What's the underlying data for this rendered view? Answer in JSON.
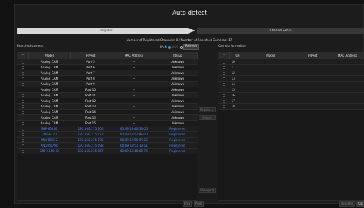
{
  "window": {
    "title": "Auto detect"
  },
  "steps": {
    "step1": "Register",
    "step2": "Channel Setup"
  },
  "info": "Number of Registered Channels: 0 / Number of Searched Cameras: 17",
  "searched": {
    "label": "Searched camera",
    "ipv4_label": "IPv4",
    "ipv6_label": "IPv6",
    "refresh_label": "Refresh",
    "columns": [
      "Model",
      "IP/Port",
      "MAC Address",
      "Status"
    ],
    "rows": [
      {
        "model": "Analog CAM",
        "ip": "Port 5",
        "mac": "--",
        "status": "Unknown",
        "kind": "analog"
      },
      {
        "model": "Analog CAM",
        "ip": "Port 6",
        "mac": "--",
        "status": "Unknown",
        "kind": "analog"
      },
      {
        "model": "Analog CAM",
        "ip": "Port 7",
        "mac": "--",
        "status": "Unknown",
        "kind": "analog"
      },
      {
        "model": "Analog CAM",
        "ip": "Port 8",
        "mac": "--",
        "status": "Unknown",
        "kind": "analog"
      },
      {
        "model": "Analog CAM",
        "ip": "Port 9",
        "mac": "--",
        "status": "Unknown",
        "kind": "analog"
      },
      {
        "model": "Analog CAM",
        "ip": "Port 10",
        "mac": "--",
        "status": "Unknown",
        "kind": "analog"
      },
      {
        "model": "Analog CAM",
        "ip": "Port 11",
        "mac": "--",
        "status": "Unknown",
        "kind": "analog"
      },
      {
        "model": "Analog CAM",
        "ip": "Port 12",
        "mac": "--",
        "status": "Unknown",
        "kind": "analog"
      },
      {
        "model": "Analog CAM",
        "ip": "Port 13",
        "mac": "--",
        "status": "Unknown",
        "kind": "analog"
      },
      {
        "model": "Analog CAM",
        "ip": "Port 14",
        "mac": "--",
        "status": "Unknown",
        "kind": "analog"
      },
      {
        "model": "Analog CAM",
        "ip": "Port 15",
        "mac": "--",
        "status": "Unknown",
        "kind": "analog"
      },
      {
        "model": "Analog CAM",
        "ip": "Port 16",
        "mac": "--",
        "status": "Unknown",
        "kind": "analog"
      },
      {
        "model": "SNP-6010B",
        "ip": "192.168.215.100",
        "mac": "00:09:18:40:53:0D",
        "status": "Registered",
        "kind": "net"
      },
      {
        "model": "XNP-6120",
        "ip": "192.168.215.122",
        "mac": "00:09:18:52:9E:0D",
        "status": "Registered",
        "kind": "net"
      },
      {
        "model": "XNV-6081Z",
        "ip": "192.168.215.136",
        "mac": "00:09:18:56:0A:1C",
        "status": "Registered",
        "kind": "net"
      },
      {
        "model": "XNO-6070R",
        "ip": "192.168.215.198",
        "mac": "00:09:18:51:13:11",
        "status": "Registered",
        "kind": "net"
      },
      {
        "model": "XNP-6040HD",
        "ip": "192.168.215.167",
        "mac": "00:09:18:48:60:7C",
        "status": "Registered",
        "kind": "net"
      }
    ]
  },
  "toregister": {
    "label": "Camera to register",
    "columns": [
      "CH",
      "Model",
      "IP/Port",
      "MAC Address"
    ],
    "channels": [
      "10",
      "11",
      "12",
      "13",
      "14",
      "15",
      "16",
      "17",
      "18"
    ]
  },
  "mid_buttons": {
    "register": "Register ▷",
    "delete": "Delete",
    "change_ip": "Change IP"
  },
  "bottom": {
    "prev": "Prev",
    "next": "Next",
    "register": "Register",
    "cancel": "Ca"
  }
}
